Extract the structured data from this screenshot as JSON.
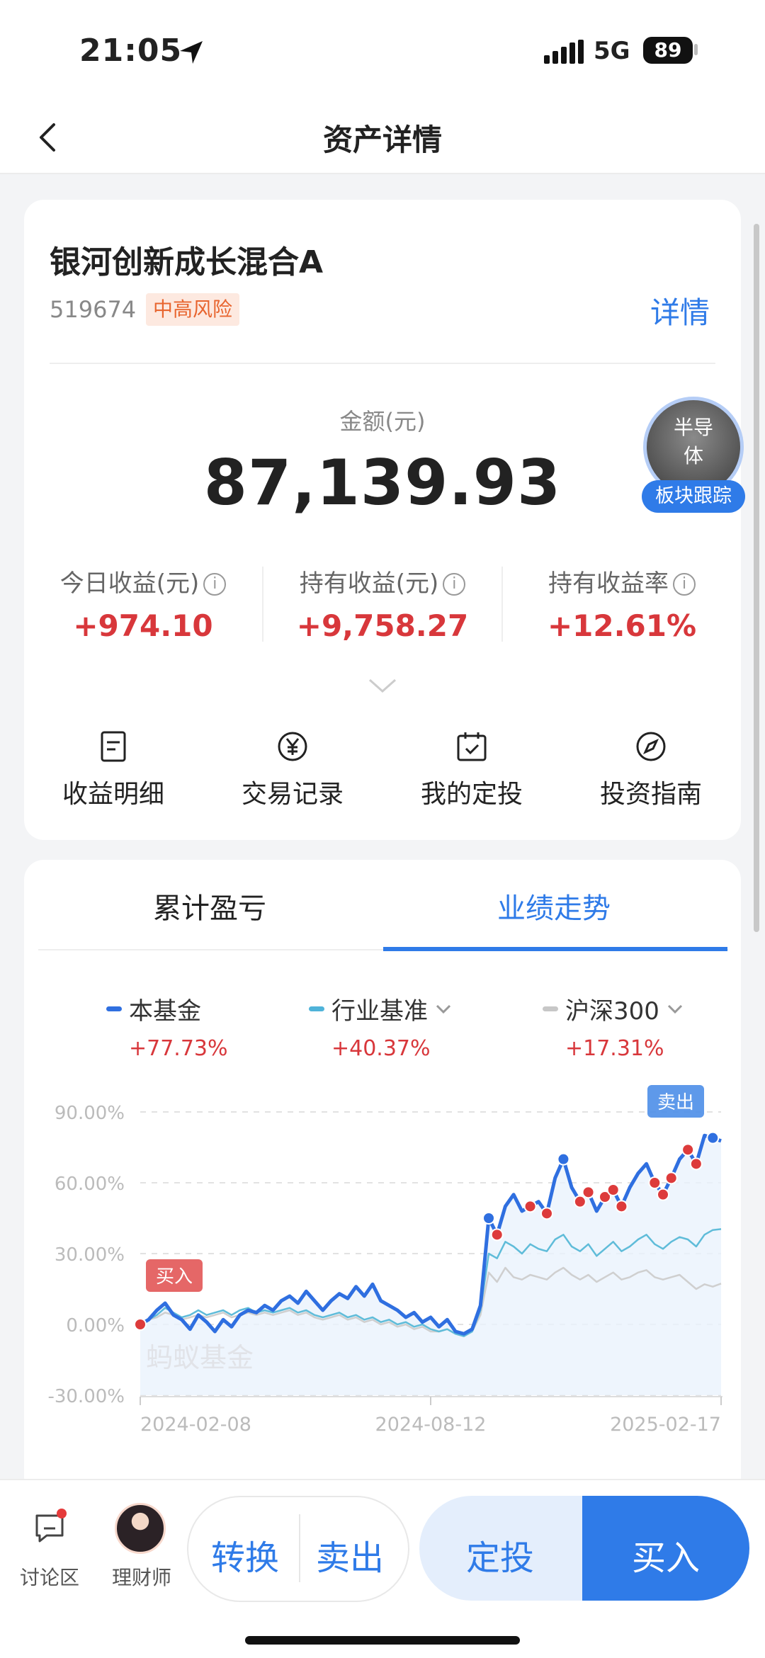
{
  "status_bar": {
    "time": "21:05",
    "network": "5G",
    "battery": "89"
  },
  "nav": {
    "title": "资产详情"
  },
  "fund": {
    "name": "银河创新成长混合A",
    "code": "519674",
    "risk": "中高风险",
    "detail_link": "详情"
  },
  "amount": {
    "label": "金额(元)",
    "value": "87,139.93"
  },
  "sector": {
    "name": "半导体",
    "badge": "板块跟踪"
  },
  "stats": [
    {
      "label": "今日收益(元)",
      "value": "+974.10"
    },
    {
      "label": "持有收益(元)",
      "value": "+9,758.27"
    },
    {
      "label": "持有收益率",
      "value": "+12.61%"
    }
  ],
  "actions": [
    {
      "label": "收益明细",
      "icon": "document-icon"
    },
    {
      "label": "交易记录",
      "icon": "yen-icon"
    },
    {
      "label": "我的定投",
      "icon": "calendar-icon"
    },
    {
      "label": "投资指南",
      "icon": "compass-icon"
    }
  ],
  "tabs": [
    {
      "label": "累计盈亏",
      "active": false
    },
    {
      "label": "业绩走势",
      "active": true
    }
  ],
  "legend": [
    {
      "name": "本基金",
      "value": "+77.73%",
      "color": "#2f6fe0"
    },
    {
      "name": "行业基准",
      "value": "+40.37%",
      "color": "#4fb3d9"
    },
    {
      "name": "沪深300",
      "value": "+17.31%",
      "color": "#c7c7c7"
    }
  ],
  "chart_data": {
    "type": "line",
    "y_ticks": [
      "90.00%",
      "60.00%",
      "30.00%",
      "0.00%",
      "-30.00%"
    ],
    "ylim": [
      -30,
      90
    ],
    "x_ticks": [
      "2024-02-08",
      "2024-08-12",
      "2025-02-17"
    ],
    "watermark": "蚂蚁基金",
    "buy_tag": "买入",
    "sell_tag": "卖出",
    "series": [
      {
        "name": "本基金",
        "color": "#2f6fe0",
        "values": [
          0,
          2,
          6,
          9,
          4,
          2,
          -2,
          4,
          1,
          -3,
          2,
          -1,
          4,
          6,
          5,
          8,
          6,
          10,
          12,
          9,
          14,
          10,
          6,
          10,
          13,
          11,
          16,
          12,
          17,
          10,
          8,
          6,
          3,
          5,
          1,
          3,
          -1,
          2,
          -3,
          -4,
          -2,
          8,
          45,
          38,
          50,
          55,
          48,
          50,
          52,
          47,
          62,
          70,
          58,
          52,
          56,
          48,
          54,
          57,
          50,
          58,
          64,
          68,
          60,
          55,
          62,
          70,
          74,
          68,
          80,
          79,
          77.73
        ]
      },
      {
        "name": "行业基准",
        "color": "#5fbcd9",
        "values": [
          0,
          2,
          4,
          7,
          5,
          3,
          4,
          6,
          4,
          5,
          6,
          4,
          6,
          7,
          5,
          6,
          5,
          6,
          7,
          5,
          6,
          4,
          3,
          4,
          5,
          3,
          4,
          2,
          3,
          1,
          2,
          0,
          1,
          -1,
          0,
          -2,
          -3,
          -2,
          -4,
          -5,
          -3,
          6,
          30,
          28,
          35,
          33,
          30,
          34,
          32,
          31,
          36,
          38,
          33,
          31,
          34,
          29,
          32,
          35,
          31,
          33,
          36,
          38,
          34,
          32,
          35,
          37,
          36,
          33,
          38,
          40,
          40.37
        ]
      },
      {
        "name": "沪深300",
        "color": "#cfcfcf",
        "values": [
          0,
          2,
          3,
          5,
          4,
          2,
          3,
          4,
          3,
          4,
          5,
          3,
          4,
          5,
          4,
          5,
          4,
          5,
          6,
          4,
          5,
          3,
          2,
          3,
          4,
          2,
          3,
          1,
          2,
          0,
          1,
          -1,
          0,
          -2,
          -1,
          -3,
          -3,
          -2,
          -4,
          -5,
          -3,
          4,
          22,
          18,
          24,
          20,
          19,
          21,
          20,
          19,
          22,
          24,
          21,
          19,
          21,
          18,
          20,
          22,
          19,
          20,
          22,
          23,
          20,
          19,
          20,
          21,
          18,
          15,
          17,
          16,
          17.31
        ]
      }
    ],
    "sell_points": [
      0,
      43,
      47,
      49,
      53,
      54,
      56,
      57,
      58,
      62,
      63,
      64,
      66,
      67
    ],
    "buy_points": [
      42,
      51,
      69
    ]
  },
  "bottom_bar": {
    "forum": "讨论区",
    "advisor": "理财师",
    "convert": "转换",
    "sell": "卖出",
    "dingtou": "定投",
    "buy": "买入"
  }
}
